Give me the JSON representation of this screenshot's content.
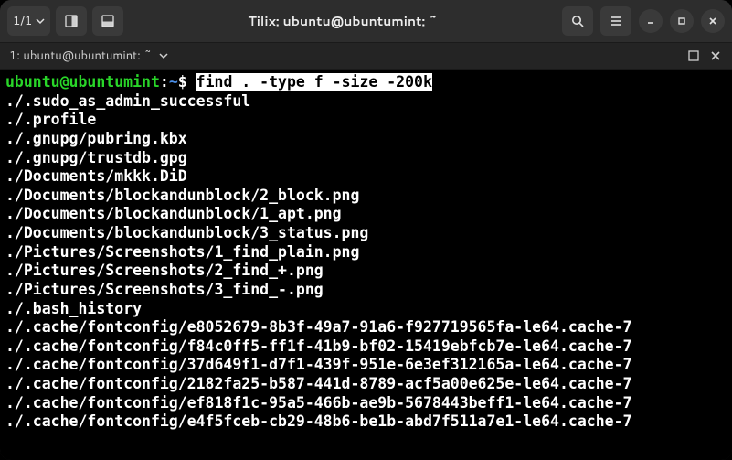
{
  "titlebar": {
    "page_counter": "1/1",
    "title": "Tilix: ubuntu@ubuntumint: ~"
  },
  "tab": {
    "label": "1: ubuntu@ubuntumint: ~"
  },
  "prompt": {
    "user_host": "ubuntu@ubuntumint",
    "sep1": ":",
    "path": "~",
    "sep2": "$ ",
    "command": "find . -type f -size -200k"
  },
  "output": [
    "./.sudo_as_admin_successful",
    "./.profile",
    "./.gnupg/pubring.kbx",
    "./.gnupg/trustdb.gpg",
    "./Documents/mkkk.DiD",
    "./Documents/blockandunblock/2_block.png",
    "./Documents/blockandunblock/1_apt.png",
    "./Documents/blockandunblock/3_status.png",
    "./Pictures/Screenshots/1_find_plain.png",
    "./Pictures/Screenshots/2_find_+.png",
    "./Pictures/Screenshots/3_find_-.png",
    "./.bash_history",
    "./.cache/fontconfig/e8052679-8b3f-49a7-91a6-f927719565fa-le64.cache-7",
    "./.cache/fontconfig/f84c0ff5-ff1f-41b9-bf02-15419ebfcb7e-le64.cache-7",
    "./.cache/fontconfig/37d649f1-d7f1-439f-951e-6e3ef312165a-le64.cache-7",
    "./.cache/fontconfig/2182fa25-b587-441d-8789-acf5a00e625e-le64.cache-7",
    "./.cache/fontconfig/ef818f1c-95a5-466b-ae9b-5678443beff1-le64.cache-7",
    "./.cache/fontconfig/e4f5fceb-cb29-48b6-be1b-abd7f511a7e1-le64.cache-7"
  ]
}
